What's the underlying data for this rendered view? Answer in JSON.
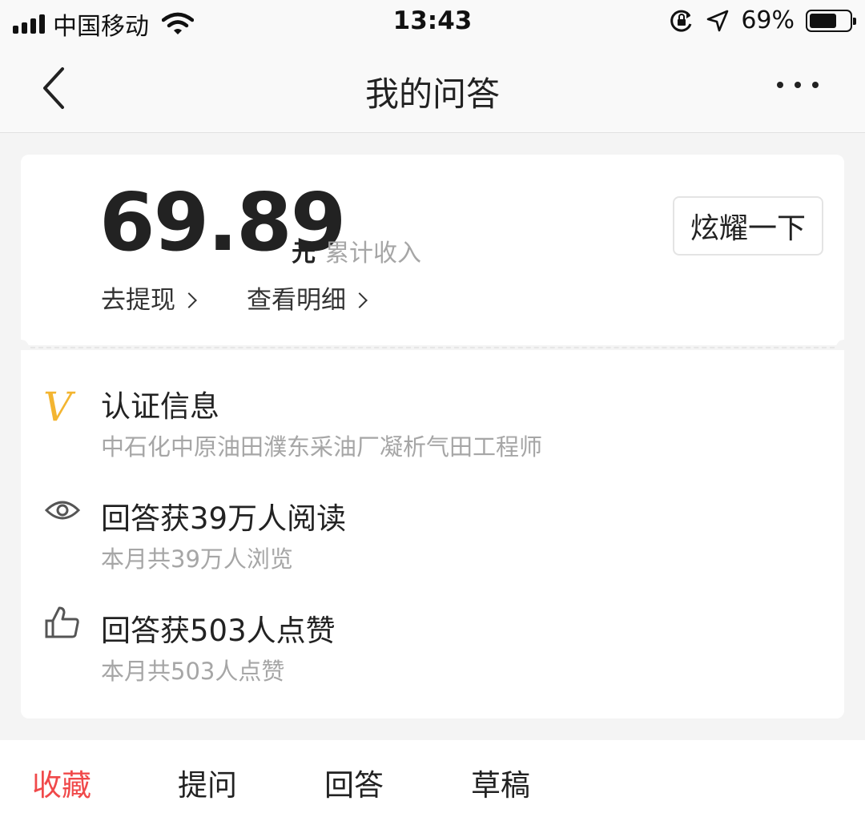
{
  "status_bar": {
    "carrier": "中国移动",
    "time": "13:43",
    "battery_percent": "69%",
    "battery_level": 0.69
  },
  "nav": {
    "title": "我的问答"
  },
  "earnings": {
    "amount": "69.89",
    "currency": "元",
    "label": "累计收入",
    "withdraw": "去提现",
    "detail": "查看明细",
    "show_off": "炫耀一下"
  },
  "stats": [
    {
      "icon": "verified-v-icon",
      "title": "认证信息",
      "subtitle": "中石化中原油田濮东采油厂凝析气田工程师",
      "accent": "#f3b531"
    },
    {
      "icon": "eye-icon",
      "title": "回答获39万人阅读",
      "subtitle": "本月共39万人浏览"
    },
    {
      "icon": "thumbs-up-icon",
      "title": "回答获503人点赞",
      "subtitle": "本月共503人点赞"
    }
  ],
  "tabs": [
    {
      "label": "收藏",
      "active": true
    },
    {
      "label": "提问",
      "active": false
    },
    {
      "label": "回答",
      "active": false
    },
    {
      "label": "草稿",
      "active": false
    }
  ],
  "colors": {
    "accent_red": "#f0494a",
    "badge_gold": "#f3b531",
    "background": "#f4f4f4"
  }
}
